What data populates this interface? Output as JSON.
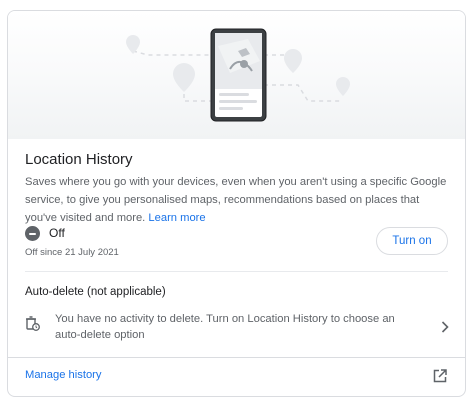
{
  "section": {
    "title": "Location History",
    "description": "Saves where you go with your devices, even when you aren't using a specific Google service, to give you personalised maps, recommendations based on places that you've visited and more.",
    "learn_more": "Learn more"
  },
  "status": {
    "state": "Off",
    "since": "Off since 21 July 2021",
    "turn_on_label": "Turn on"
  },
  "auto_delete": {
    "title": "Auto-delete (not applicable)",
    "message": "You have no activity to delete. Turn on Location History to choose an auto-delete option"
  },
  "footer": {
    "manage_label": "Manage history"
  },
  "icons": {
    "status": "minus-circle-icon",
    "auto_delete": "auto-delete-icon",
    "chevron": "chevron-right-icon",
    "external": "open-in-new-icon"
  },
  "colors": {
    "accent": "#1a73e8",
    "text_primary": "#202124",
    "text_secondary": "#5f6368",
    "border": "#dadce0"
  }
}
